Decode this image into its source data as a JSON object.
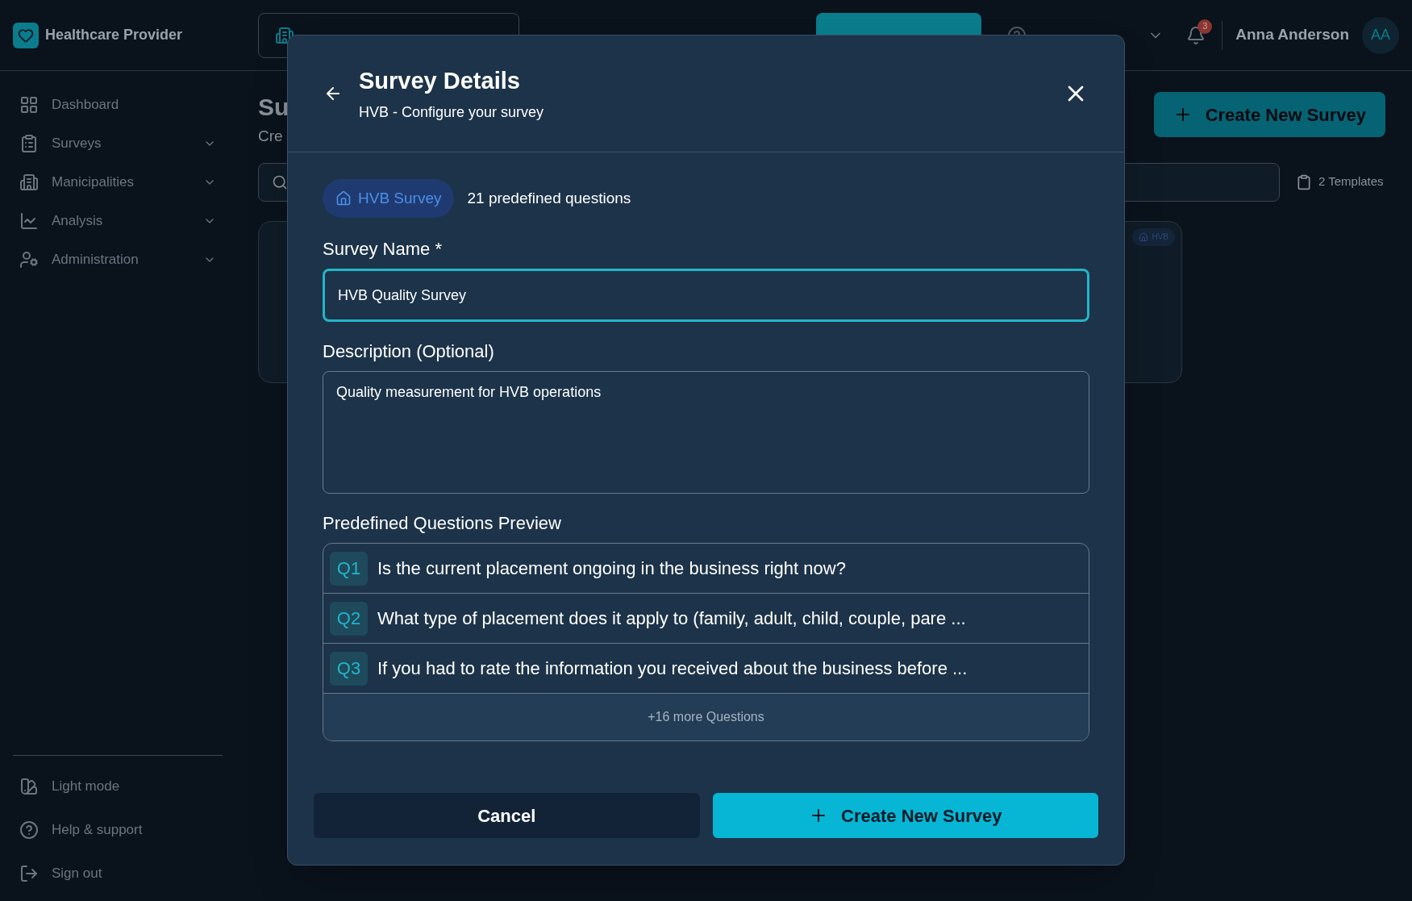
{
  "header": {
    "brand": "Healthcare Provider",
    "notifications": "3",
    "user_name": "Anna Anderson",
    "user_initials": "AA"
  },
  "sidebar": {
    "items": [
      {
        "label": "Dashboard",
        "expandable": false
      },
      {
        "label": "Surveys",
        "expandable": true
      },
      {
        "label": "Manicipalities",
        "expandable": true
      },
      {
        "label": "Analysis",
        "expandable": true
      },
      {
        "label": "Administration",
        "expandable": true
      }
    ],
    "footer": [
      {
        "label": "Light mode"
      },
      {
        "label": "Help & support"
      },
      {
        "label": "Sign out"
      }
    ]
  },
  "page": {
    "title": "Su",
    "subtitle": "Cre",
    "create_button": "Create New Survey",
    "templates": "2 Templates",
    "card": {
      "tag": "HVB"
    }
  },
  "modal": {
    "title": "Survey Details",
    "subtitle": "HVB - Configure your survey",
    "chip": "HVB Survey",
    "question_count": "21 predefined questions",
    "name_label": "Survey Name *",
    "name_value": "HVB Quality Survey",
    "description_label": "Description (Optional)",
    "description_value": "Quality measurement for HVB operations",
    "preview_label": "Predefined Questions Preview",
    "questions": [
      {
        "number": "Q1",
        "text": "Is the current placement ongoing in the business right now?"
      },
      {
        "number": "Q2",
        "text": "What type of placement does it apply to (family, adult, child, couple, pare ..."
      },
      {
        "number": "Q3",
        "text": "If you had to rate the information you received about the business before ..."
      }
    ],
    "more": "+16 more Questions",
    "cancel": "Cancel",
    "create": "Create New Survey"
  }
}
